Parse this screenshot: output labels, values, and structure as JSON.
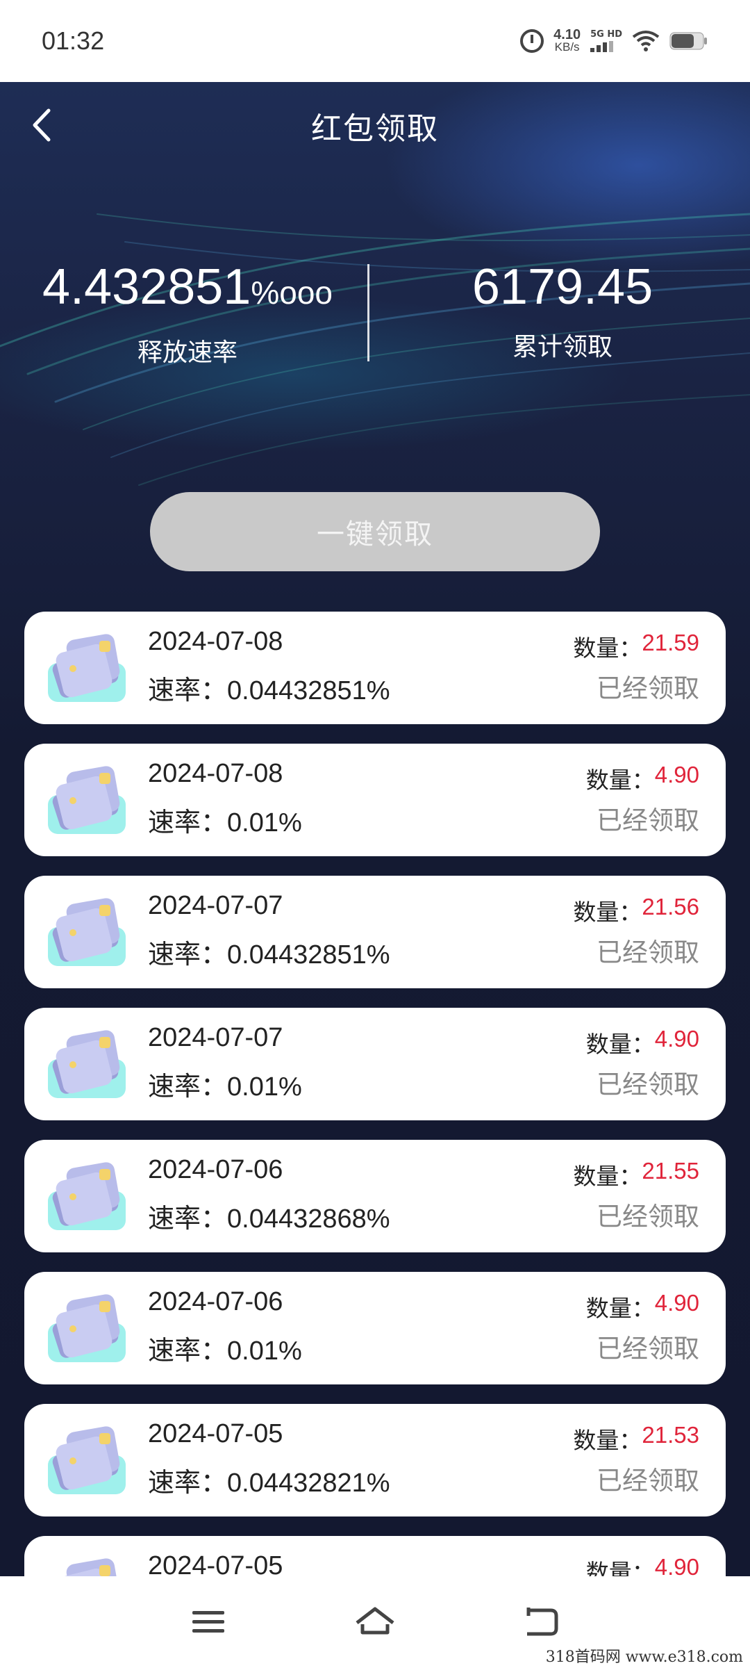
{
  "status_bar": {
    "time": "01:32",
    "net_speed_value": "4.10",
    "net_speed_unit": "KB/s",
    "network_label": "5G HD",
    "icons": [
      "alarm-icon",
      "signal-icon",
      "wifi-icon",
      "battery-icon"
    ]
  },
  "header": {
    "title": "红包领取",
    "back_icon": "chevron-left-icon"
  },
  "stats": {
    "release_rate_value": "4.432851",
    "release_rate_unit": "%ooo",
    "release_rate_label": "释放速率",
    "total_claimed_value": "6179.45",
    "total_claimed_label": "累计领取"
  },
  "claim_all_button": "一键领取",
  "records": [
    {
      "date": "2024-07-08",
      "rate": "速率：0.04432851%",
      "amount_label": "数量：",
      "amount": "21.59",
      "status": "已经领取"
    },
    {
      "date": "2024-07-08",
      "rate": "速率：0.01%",
      "amount_label": "数量：",
      "amount": "4.90",
      "status": "已经领取"
    },
    {
      "date": "2024-07-07",
      "rate": "速率：0.04432851%",
      "amount_label": "数量：",
      "amount": "21.56",
      "status": "已经领取"
    },
    {
      "date": "2024-07-07",
      "rate": "速率：0.01%",
      "amount_label": "数量：",
      "amount": "4.90",
      "status": "已经领取"
    },
    {
      "date": "2024-07-06",
      "rate": "速率：0.04432868%",
      "amount_label": "数量：",
      "amount": "21.55",
      "status": "已经领取"
    },
    {
      "date": "2024-07-06",
      "rate": "速率：0.01%",
      "amount_label": "数量：",
      "amount": "4.90",
      "status": "已经领取"
    },
    {
      "date": "2024-07-05",
      "rate": "速率：0.04432821%",
      "amount_label": "数量：",
      "amount": "21.53",
      "status": "已经领取"
    },
    {
      "date": "2024-07-05",
      "rate": "",
      "amount_label": "数量：",
      "amount": "4.90",
      "status": ""
    }
  ],
  "bottom_nav": {
    "icons": [
      "menu-icon",
      "home-icon",
      "back-icon"
    ]
  },
  "watermark": "318首码网  www.e318.com",
  "colors": {
    "amount": "#e0243a",
    "claim_button_bg": "#c9c9c9",
    "hero_bg": "#1a2343"
  }
}
